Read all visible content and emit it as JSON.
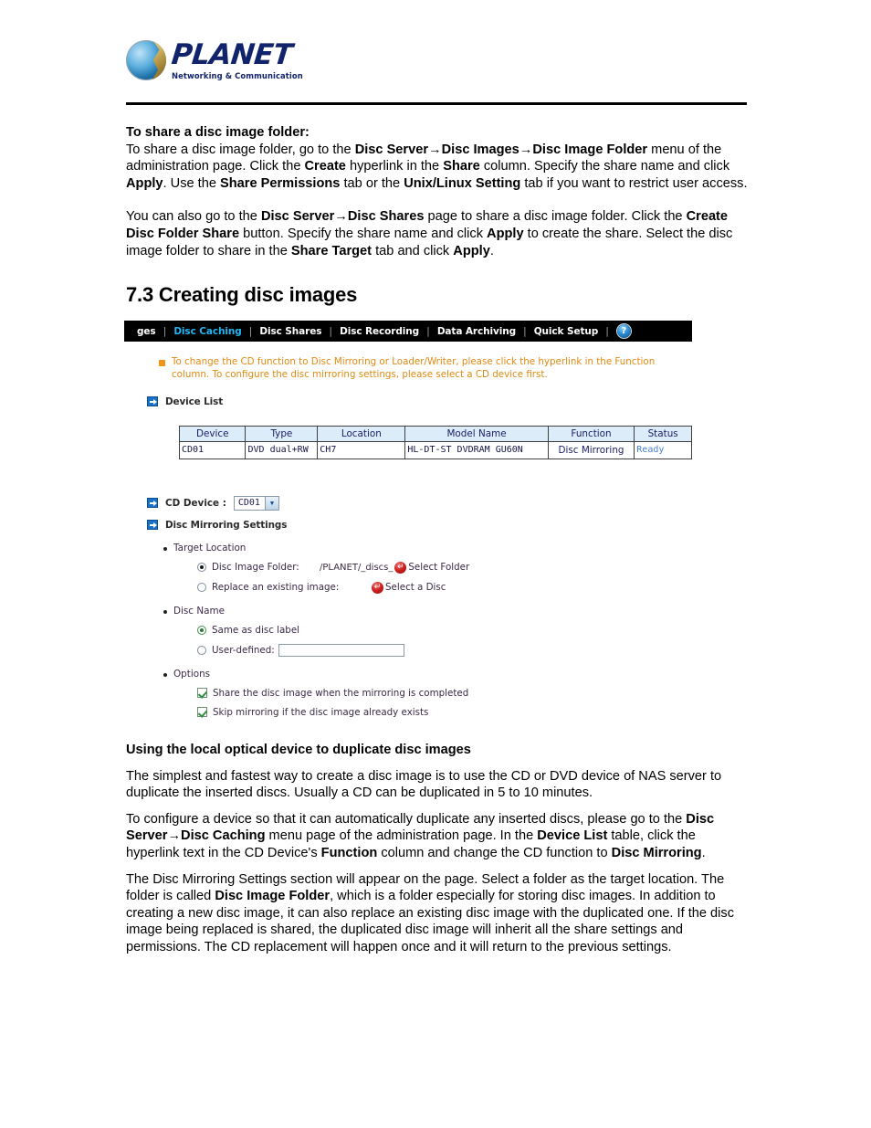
{
  "header": {
    "logo_word": "PLANET",
    "logo_tagline": "Networking & Communication"
  },
  "doc": {
    "p1_heading": "To share a disc image folder:",
    "p1_line1_a": "To share a disc image folder, go to the ",
    "p1_b1": "Disc Server",
    "p1_arrow1": "→",
    "p1_b2": "Disc Images",
    "p1_arrow2": "→",
    "p1_b3": "Disc Image Folder",
    "p1_line1_b": " menu of the administration page. Click the ",
    "p1_b4": "Create",
    "p1_line1_c": " hyperlink in the ",
    "p1_b5": "Share",
    "p1_line1_d": " column. Specify the share name and click ",
    "p1_b6": "Apply",
    "p1_line1_e": ". Use the ",
    "p1_b7": "Share Permissions",
    "p1_line1_f": " tab or the ",
    "p1_b8": "Unix/Linux Setting",
    "p1_line1_g": " tab if you want to restrict user access.",
    "p2_a": "You can also go to the ",
    "p2_b1": "Disc Server",
    "p2_arrow1": "→",
    "p2_b2": "Disc Shares",
    "p2_b_": " page to share a disc image folder. Click the ",
    "p2_b3": "Create Disc Folder Share",
    "p2_c": " button. Specify the share name and click ",
    "p2_b4": "Apply",
    "p2_d": " to create the share. Select the disc image folder to share in the ",
    "p2_b5": "Share Target",
    "p2_e": " tab and click ",
    "p2_b6": "Apply",
    "p2_f": ".",
    "section_title": "7.3 Creating disc images",
    "sub_title": "Using the local optical device to duplicate disc images",
    "p3": "The simplest and fastest way to create a disc image is to use the CD or DVD device of NAS server to duplicate the inserted discs. Usually a CD can be duplicated in 5 to 10 minutes.",
    "p4_a": "To configure a device so that it can automatically duplicate any inserted discs, please go to the ",
    "p4_b1": "Disc Server",
    "p4_arrow1": "→",
    "p4_b2": "Disc Caching",
    "p4_b": " menu page of the administration page. In the ",
    "p4_b3": "Device List",
    "p4_c": " table, click the hyperlink text in the CD Device's ",
    "p4_b4": "Function",
    "p4_d": " column and change the CD function to ",
    "p4_b5": "Disc Mirroring",
    "p4_e": ".",
    "p5_a": "The Disc Mirroring Settings section will appear on the page. Select a folder as the target location. The folder is called ",
    "p5_b1": "Disc Image Folder",
    "p5_b": ", which is a folder especially for storing disc images. In addition to creating a new disc image, it can also replace an existing disc image with the duplicated one. If the disc image being replaced is shared, the duplicated disc image will inherit all the share settings and permissions. The CD replacement will happen once and it will return to the previous settings."
  },
  "screenshot": {
    "nav": {
      "items": [
        {
          "label": "ges",
          "active": false
        },
        {
          "label": "Disc Caching",
          "active": true
        },
        {
          "label": "Disc Shares",
          "active": false
        },
        {
          "label": "Disc Recording",
          "active": false
        },
        {
          "label": "Data Archiving",
          "active": false
        },
        {
          "label": "Quick Setup",
          "active": false
        }
      ],
      "separator": "|",
      "help_icon_label": "?",
      "active_color": "#22b6f2",
      "background_color": "#000000"
    },
    "note": {
      "text": "To change the CD function to Disc Mirroring or Loader/Writer, please click the hyperlink in the Function column. To configure the disc mirroring settings, please select a CD device first.",
      "color": "#e08a12"
    },
    "device_list": {
      "title": "Device List",
      "columns": [
        "Device",
        "Type",
        "Location",
        "Model Name",
        "Function",
        "Status"
      ],
      "rows": [
        {
          "device": "CD01",
          "type": "DVD dual+RW",
          "location": "CH7",
          "model": "HL-DT-ST DVDRAM GU60N",
          "function": "Disc Mirroring",
          "status": "Ready"
        }
      ],
      "header_bg": "#dcecf8",
      "status_color": "#4a7fd6"
    },
    "cd_device": {
      "label": "CD Device :",
      "selected": "CD01",
      "options": [
        "CD01"
      ]
    },
    "mirroring": {
      "title": "Disc Mirroring Settings",
      "target_location_label": "Target Location",
      "disc_image_folder_label": "Disc Image Folder:",
      "disc_image_folder_path": "/PLANET/_discs_",
      "select_folder_label": "Select Folder",
      "replace_existing_label": "Replace an existing image:",
      "select_disc_label": "Select a Disc",
      "disc_name_label": "Disc Name",
      "same_as_disc_label": "Same as disc label",
      "user_defined_label": "User-defined:",
      "user_defined_value": "",
      "options_label": "Options",
      "option_share_label": "Share the disc image when the mirroring is completed",
      "option_skip_label": "Skip mirroring if the disc image already exists"
    }
  }
}
